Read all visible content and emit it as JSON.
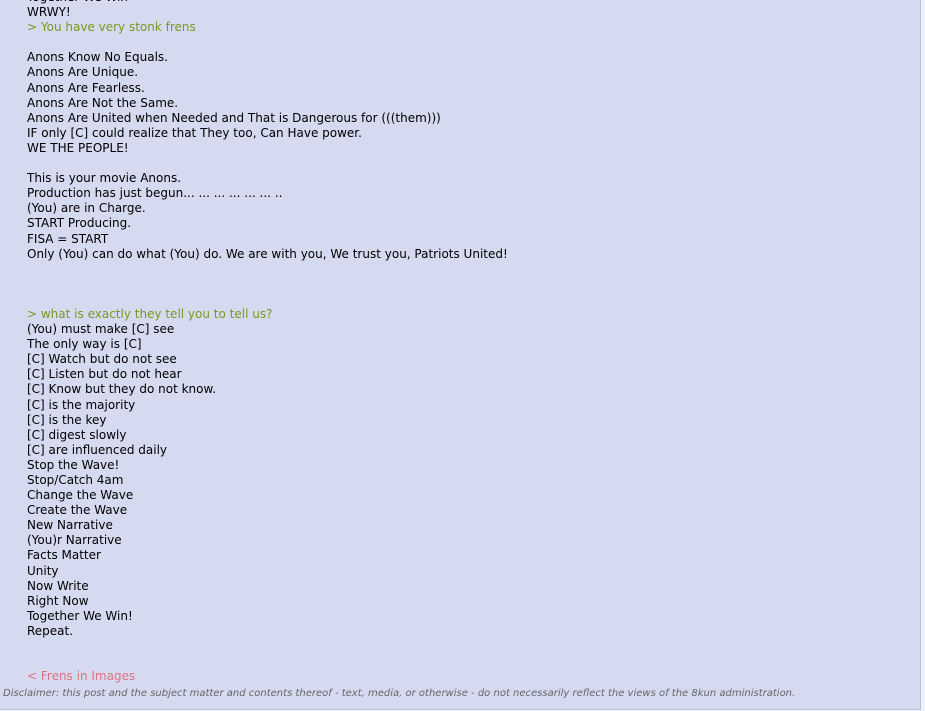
{
  "post": {
    "lines": [
      {
        "text": "Together We Win",
        "kind": "text"
      },
      {
        "text": "WRWY!",
        "kind": "text"
      },
      {
        "text": "> You have very stonk frens",
        "kind": "quote"
      },
      {
        "text": "",
        "kind": "empty"
      },
      {
        "text": "Anons Know No Equals.",
        "kind": "text"
      },
      {
        "text": "Anons Are Unique.",
        "kind": "text"
      },
      {
        "text": "Anons Are Fearless.",
        "kind": "text"
      },
      {
        "text": "Anons Are Not the Same.",
        "kind": "text"
      },
      {
        "text": "Anons Are United when Needed and That is Dangerous for (((them)))",
        "kind": "text"
      },
      {
        "text": "IF only [C] could realize that They too, Can Have power.",
        "kind": "text"
      },
      {
        "text": "WE THE PEOPLE!",
        "kind": "text"
      },
      {
        "text": "",
        "kind": "empty"
      },
      {
        "text": "This is your movie Anons.",
        "kind": "text"
      },
      {
        "text": "Production has just begun... ... ... ... ... ... ..",
        "kind": "text"
      },
      {
        "text": "(You) are in Charge.",
        "kind": "text"
      },
      {
        "text": "START Producing.",
        "kind": "text"
      },
      {
        "text": "FISA = START",
        "kind": "text"
      },
      {
        "text": "Only (You) can do what (You) do. We are with you, We trust you, Patriots United!",
        "kind": "text"
      },
      {
        "text": "",
        "kind": "empty"
      },
      {
        "text": "",
        "kind": "empty"
      },
      {
        "text": "",
        "kind": "empty"
      },
      {
        "text": "> what is exactly they tell you to tell us?",
        "kind": "quote"
      },
      {
        "text": "(You) must make [C] see",
        "kind": "text"
      },
      {
        "text": "The only way is [C]",
        "kind": "text"
      },
      {
        "text": "[C] Watch but do not see",
        "kind": "text"
      },
      {
        "text": "[C] Listen but do not hear",
        "kind": "text"
      },
      {
        "text": "[C] Know but they do not know.",
        "kind": "text"
      },
      {
        "text": "[C] is the majority",
        "kind": "text"
      },
      {
        "text": "[C] is the key",
        "kind": "text"
      },
      {
        "text": "[C] digest slowly",
        "kind": "text"
      },
      {
        "text": "[C] are influenced daily",
        "kind": "text"
      },
      {
        "text": "Stop the Wave!",
        "kind": "text"
      },
      {
        "text": "Stop/Catch 4am",
        "kind": "text"
      },
      {
        "text": "Change the Wave",
        "kind": "text"
      },
      {
        "text": "Create the Wave",
        "kind": "text"
      },
      {
        "text": "New Narrative",
        "kind": "text"
      },
      {
        "text": "(You)r Narrative",
        "kind": "text"
      },
      {
        "text": "Facts Matter",
        "kind": "text"
      },
      {
        "text": "Unity",
        "kind": "text"
      },
      {
        "text": "Now Write",
        "kind": "text"
      },
      {
        "text": "Right Now",
        "kind": "text"
      },
      {
        "text": "Together We Win!",
        "kind": "text"
      },
      {
        "text": "Repeat.",
        "kind": "text"
      },
      {
        "text": "",
        "kind": "empty"
      },
      {
        "text": "",
        "kind": "empty"
      },
      {
        "text": "< Frens in Images",
        "kind": "rquote"
      }
    ]
  },
  "disclaimer": "Disclaimer: this post and the subject matter and contents thereof - text, media, or otherwise - do not necessarily reflect the views of the 8kun administration.",
  "colors": {
    "post_background": "#d6daf0",
    "page_background": "#eef2ff",
    "greentext": "#789922",
    "pinktext": "#e0727f",
    "text": "#000000"
  }
}
